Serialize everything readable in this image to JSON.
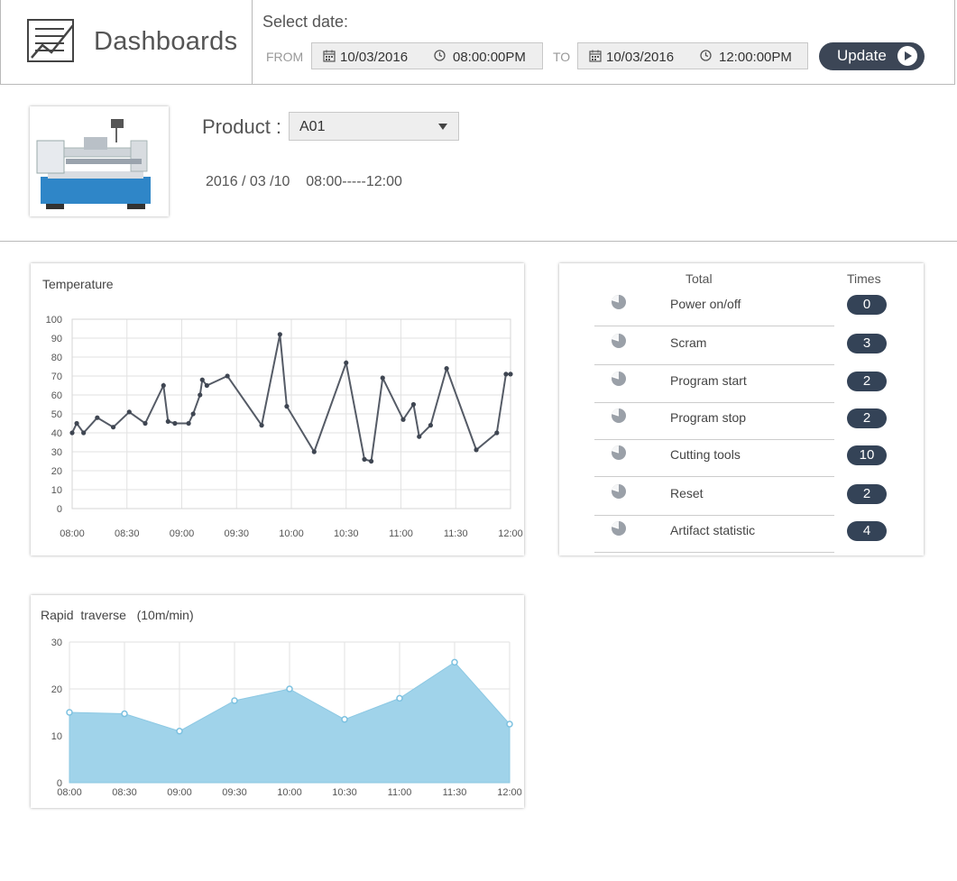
{
  "header": {
    "app_title": "Dashboards",
    "select_label": "Select date:",
    "from_label": "FROM",
    "to_label": "TO",
    "from_date": "10/03/2016",
    "from_time": "08:00:00PM",
    "to_date": "10/03/2016",
    "to_time": "12:00:00PM",
    "update_label": "Update",
    "icons": {
      "logo": "line-chart-icon",
      "calendar": "calendar-icon",
      "clock": "clock-icon",
      "update": "play-icon"
    }
  },
  "product": {
    "label": "Product :",
    "selected": "A01",
    "range_text": "2016 / 03 /10    08:00-----12:00",
    "image": "lathe-machine-image"
  },
  "temperature": {
    "title": "Temperature",
    "y_ticks": [
      "100",
      "90",
      "80",
      "70",
      "60",
      "50",
      "40",
      "30",
      "20",
      "10",
      "0"
    ],
    "x_ticks": [
      "08:00",
      "08:30",
      "09:00",
      "09:30",
      "10:00",
      "10:30",
      "11:00",
      "11:30",
      "12:00"
    ]
  },
  "rapid": {
    "title": "Rapid  traverse   (10m/min)",
    "y_ticks": [
      "30",
      "20",
      "10",
      "0"
    ],
    "x_ticks": [
      "08:00",
      "08:30",
      "09:00",
      "09:30",
      "10:00",
      "10:30",
      "11:00",
      "11:30",
      "12:00"
    ]
  },
  "stats": {
    "col_total": "Total",
    "col_times": "Times",
    "rows": [
      {
        "name": "Power on/off",
        "times": "0"
      },
      {
        "name": "Scram",
        "times": "3"
      },
      {
        "name": "Program start",
        "times": "2"
      },
      {
        "name": "Program stop",
        "times": "2"
      },
      {
        "name": "Cutting tools",
        "times": "10"
      },
      {
        "name": "Reset",
        "times": "2"
      },
      {
        "name": "Artifact statistic",
        "times": "4"
      }
    ]
  },
  "colors": {
    "accent": "#344357",
    "line": "#555b66",
    "area": "#a0d3ea",
    "area_point": "#7cc1e0"
  },
  "chart_data": [
    {
      "type": "line",
      "title": "Temperature",
      "x_unit": "minutes from 08:00",
      "x": [
        0,
        4,
        10,
        22,
        36,
        50,
        64,
        80,
        84,
        90,
        102,
        106,
        112,
        114,
        118,
        136,
        166,
        182,
        188,
        212,
        240,
        256,
        262,
        272,
        290,
        299,
        304,
        314,
        328,
        354,
        372,
        380,
        384
      ],
      "y": [
        40,
        45,
        40,
        48,
        43,
        51,
        45,
        65,
        46,
        45,
        45,
        50,
        60,
        68,
        65,
        70,
        44,
        92,
        54,
        30,
        77,
        26,
        25,
        69,
        47,
        55,
        38,
        44,
        74,
        31,
        40,
        71,
        71
      ],
      "ylim": [
        0,
        100
      ],
      "xlim": [
        0,
        240
      ],
      "x_tick_labels": [
        "08:00",
        "08:30",
        "09:00",
        "09:30",
        "10:00",
        "10:30",
        "11:00",
        "11:30",
        "12:00"
      ],
      "note_values_in_minutes_scaled": true
    },
    {
      "type": "area",
      "title": "Rapid  traverse   (10m/min)",
      "categories": [
        "08:00",
        "08:30",
        "09:00",
        "09:30",
        "10:00",
        "10:30",
        "11:00",
        "11:30",
        "12:00"
      ],
      "values": [
        15,
        14.7,
        11,
        17.5,
        20,
        13.5,
        18,
        25.7,
        12.5
      ],
      "ylim": [
        0,
        30
      ]
    }
  ]
}
